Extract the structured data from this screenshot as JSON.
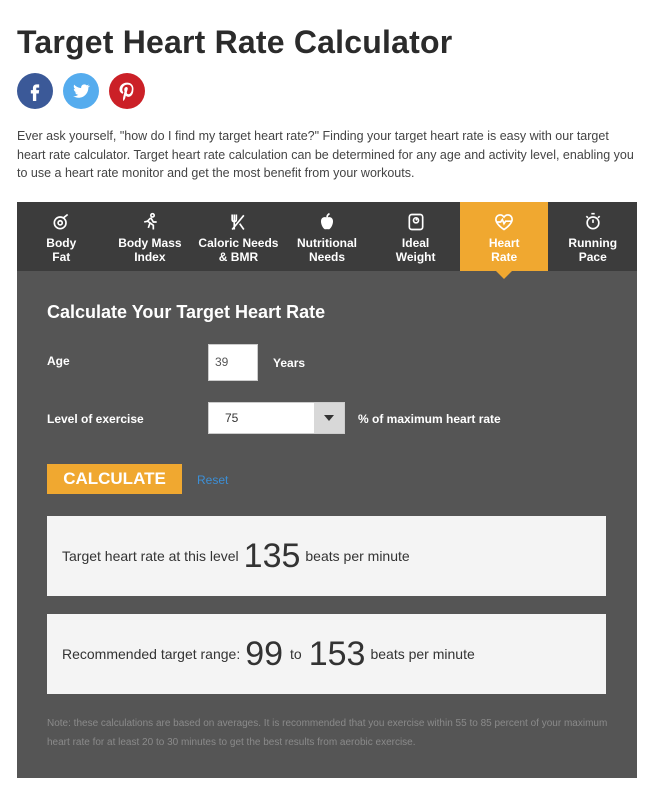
{
  "page": {
    "title": "Target Heart Rate Calculator",
    "intro": "Ever ask yourself, \"how do I find my target heart rate?\" Finding your target heart rate is easy with our target heart rate calculator. Target heart rate calculation can be determined for any age and activity level, enabling you to use a heart rate monitor and get the most benefit from your workouts."
  },
  "social": [
    {
      "name": "facebook",
      "color": "#3b5998"
    },
    {
      "name": "twitter",
      "color": "#55acee"
    },
    {
      "name": "pinterest",
      "color": "#cb2027"
    }
  ],
  "tabs": [
    {
      "line1": "Body",
      "line2": "Fat",
      "icon": "tape-measure-icon"
    },
    {
      "line1": "Body Mass",
      "line2": "Index",
      "icon": "runner-icon"
    },
    {
      "line1": "Caloric Needs",
      "line2": "& BMR",
      "icon": "fork-knife-icon"
    },
    {
      "line1": "Nutritional",
      "line2": "Needs",
      "icon": "apple-icon"
    },
    {
      "line1": "Ideal",
      "line2": "Weight",
      "icon": "scale-icon"
    },
    {
      "line1": "Heart",
      "line2": "Rate",
      "icon": "heart-pulse-icon"
    },
    {
      "line1": "Running",
      "line2": "Pace",
      "icon": "stopwatch-icon"
    }
  ],
  "form": {
    "heading": "Calculate Your Target Heart Rate",
    "age_label": "Age",
    "age_value": "39",
    "age_unit": "Years",
    "exercise_label": "Level of exercise",
    "exercise_value": "75",
    "exercise_unit": "% of maximum heart rate",
    "calculate_label": "CALCULATE",
    "reset_label": "Reset"
  },
  "results": {
    "level_prefix": "Target heart rate at this level",
    "level_value": "135",
    "level_suffix": "beats per minute",
    "range_prefix": "Recommended target range:",
    "range_low": "99",
    "range_to": "to",
    "range_high": "153",
    "range_suffix": "beats per minute"
  },
  "note": "Note: these calculations are based on averages. It is recommended that you exercise within 55 to 85 percent of your maximum heart rate for at least 20 to 30 minutes to get the best results from aerobic exercise.",
  "colors": {
    "accent": "#f0a830",
    "panel": "#555555",
    "tabbar": "#3c3c3c",
    "link": "#3c8fd6"
  }
}
